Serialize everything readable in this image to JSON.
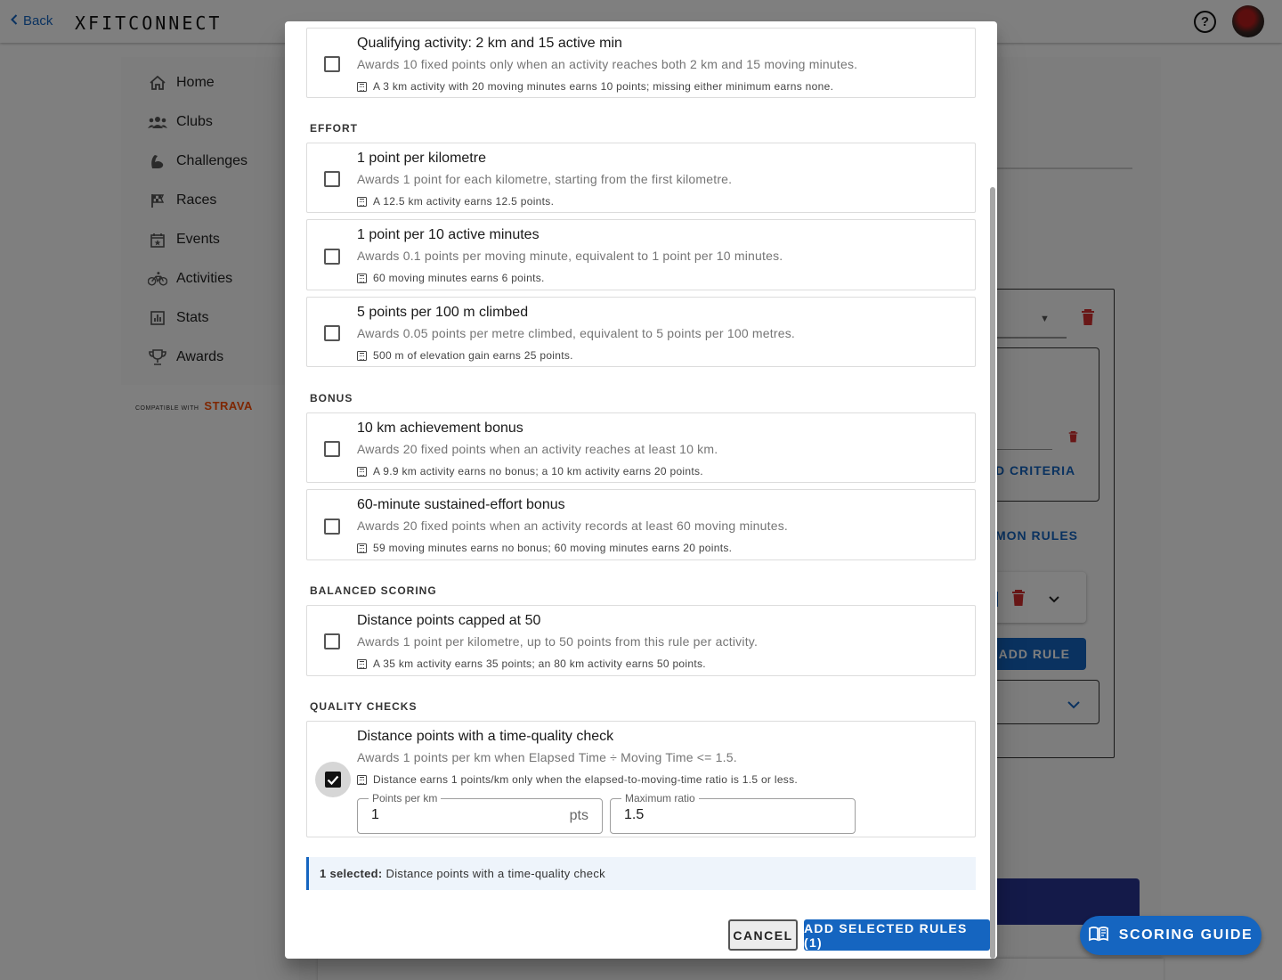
{
  "app": {
    "back_label": "Back",
    "logo_text": "XFITCONNECT",
    "help_icon": "help-circle-icon",
    "strava_prefix": "COMPATIBLE WITH",
    "strava_brand": "STRAVA",
    "brand_color": "#1565c0"
  },
  "sidebar": {
    "items": [
      {
        "label": "Home",
        "icon": "home-icon"
      },
      {
        "label": "Clubs",
        "icon": "people-icon"
      },
      {
        "label": "Challenges",
        "icon": "flexed-arm-icon"
      },
      {
        "label": "Races",
        "icon": "checkered-flag-icon"
      },
      {
        "label": "Events",
        "icon": "calendar-star-icon"
      },
      {
        "label": "Activities",
        "icon": "bike-icon"
      },
      {
        "label": "Stats",
        "icon": "bar-chart-icon"
      },
      {
        "label": "Awards",
        "icon": "trophy-icon"
      }
    ]
  },
  "background": {
    "criteria_fragment": "D CRITERIA",
    "common_rules_fragment": "MON RULES",
    "add_rule_label": "ADD RULE"
  },
  "dialog": {
    "top_rule": {
      "title": "Qualifying activity: 2 km and 15 active min",
      "desc": "Awards 10 fixed points only when an activity reaches both 2 km and 15 moving minutes.",
      "example": "A 3 km activity with 20 moving minutes earns 10 points; missing either minimum earns none.",
      "checked": false
    },
    "sections": [
      {
        "title": "EFFORT",
        "rules": [
          {
            "title": "1 point per kilometre",
            "desc": "Awards 1 point for each kilometre, starting from the first kilometre.",
            "example": "A 12.5 km activity earns 12.5 points.",
            "checked": false
          },
          {
            "title": "1 point per 10 active minutes",
            "desc": "Awards 0.1 points per moving minute, equivalent to 1 point per 10 minutes.",
            "example": "60 moving minutes earns 6 points.",
            "checked": false
          },
          {
            "title": "5 points per 100 m climbed",
            "desc": "Awards 0.05 points per metre climbed, equivalent to 5 points per 100 metres.",
            "example": "500 m of elevation gain earns 25 points.",
            "checked": false
          }
        ]
      },
      {
        "title": "BONUS",
        "rules": [
          {
            "title": "10 km achievement bonus",
            "desc": "Awards 20 fixed points when an activity reaches at least 10 km.",
            "example": "A 9.9 km activity earns no bonus; a 10 km activity earns 20 points.",
            "checked": false
          },
          {
            "title": "60-minute sustained-effort bonus",
            "desc": "Awards 20 fixed points when an activity records at least 60 moving minutes.",
            "example": "59 moving minutes earns no bonus; 60 moving minutes earns 20 points.",
            "checked": false
          }
        ]
      },
      {
        "title": "BALANCED SCORING",
        "rules": [
          {
            "title": "Distance points capped at 50",
            "desc": "Awards 1 point per kilometre, up to 50 points from this rule per activity.",
            "example": "A 35 km activity earns 35 points; an 80 km activity earns 50 points.",
            "checked": false
          }
        ]
      },
      {
        "title": "QUALITY CHECKS",
        "rules": [
          {
            "title": "Distance points with a time-quality check",
            "desc": "Awards 1 points per km when Elapsed Time ÷ Moving Time <= 1.5.",
            "example": "Distance earns 1 points/km only when the elapsed-to-moving-time ratio is 1.5 or less.",
            "checked": true,
            "fields": [
              {
                "label": "Points per km",
                "value": "1",
                "suffix": "pts"
              },
              {
                "label": "Maximum ratio",
                "value": "1.5",
                "suffix": ""
              }
            ]
          }
        ]
      }
    ],
    "selected_prefix": "1 selected:",
    "selected_text": "Distance points with a time-quality check",
    "cancel_label": "CANCEL",
    "add_label": "ADD SELECTED RULES (1)"
  },
  "fab": {
    "label": "SCORING GUIDE",
    "icon": "open-book-icon"
  }
}
